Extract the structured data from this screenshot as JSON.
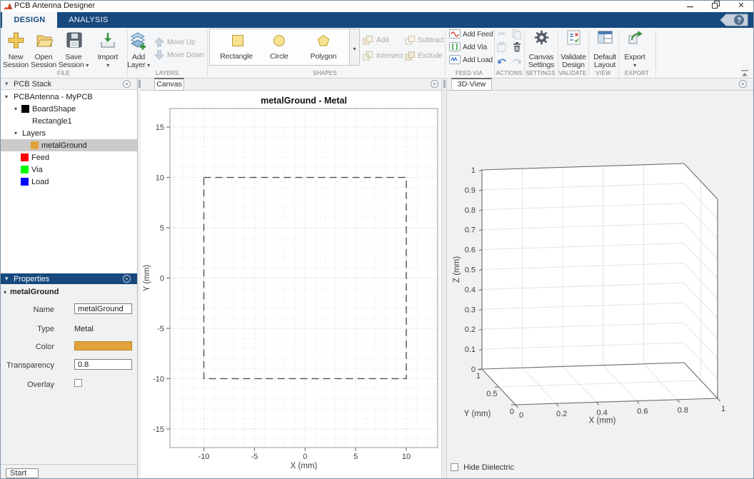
{
  "titlebar": {
    "title": "PCB Antenna Designer"
  },
  "icons": {
    "caret_down": "▾",
    "tree_caret": "▾",
    "close": "✕",
    "help": "?",
    "scissors": "✂"
  },
  "ribbon": {
    "tabs": {
      "design": "DESIGN",
      "analysis": "ANALYSIS"
    },
    "section_labels": {
      "file": "FILE",
      "layers": "LAYERS",
      "shapes": "SHAPES",
      "feed_via": "FEED VIA",
      "actions": "ACTIONS",
      "settings": "SETTINGS",
      "validate": "VALIDATE",
      "view": "VIEW",
      "export": "EXPORT"
    },
    "file": {
      "new1": "New",
      "new2": "Session",
      "open1": "Open",
      "open2": "Session",
      "save1": "Save",
      "save2": "Session",
      "import": "Import"
    },
    "layers": {
      "add1": "Add",
      "add2": "Layer",
      "move_up": "Move Up",
      "move_down": "Move Down"
    },
    "shapes": {
      "rectangle": "Rectangle",
      "circle": "Circle",
      "polygon": "Polygon"
    },
    "boolean": {
      "add": "Add",
      "subtract": "Subtract",
      "intersect": "Intersect",
      "exclude": "Exclude"
    },
    "feed_via": {
      "add_feed": "Add Feed",
      "add_via": "Add Via",
      "add_load": "Add Load"
    },
    "settings": {
      "l1": "Canvas",
      "l2": "Settings"
    },
    "validate": {
      "l1": "Validate",
      "l2": "Design"
    },
    "view": {
      "l1": "Default",
      "l2": "Layout"
    },
    "export": {
      "label": "Export"
    }
  },
  "pcb_stack": {
    "header": "PCB Stack",
    "tree": [
      {
        "label": "PCBAntenna - MyPCB"
      },
      {
        "label": "BoardShape",
        "color": "#000000"
      },
      {
        "label": "Rectangle1"
      },
      {
        "label": "Layers"
      },
      {
        "label": "metalGround",
        "color": "#E2A33C",
        "selected": true
      },
      {
        "label": "Feed",
        "color": "#FF0000"
      },
      {
        "label": "Via",
        "color": "#00FF00"
      },
      {
        "label": "Load",
        "color": "#0000FF"
      }
    ]
  },
  "properties": {
    "header": "Properties",
    "group": "metalGround",
    "name_label": "Name",
    "name_value": "metalGround",
    "type_label": "Type",
    "type_value": "Metal",
    "color_label": "Color",
    "color_value": "#E2A33C",
    "transparency_label": "Transparency",
    "transparency_value": "0.8",
    "overlay_label": "Overlay",
    "overlay_checked": false
  },
  "status": {
    "start": "Start"
  },
  "doc_tabs": {
    "canvas": "Canvas",
    "view3d": "3D-View"
  },
  "view3d_panel": {
    "hide_dielectric": "Hide Dielectric",
    "checked": false
  },
  "chart_data": [
    {
      "id": "canvas2d",
      "type": "line",
      "title": "metalGround - Metal",
      "xlabel": "X (mm)",
      "ylabel": "Y (mm)",
      "xlim": [
        -13.35,
        13.1
      ],
      "ylim": [
        -16.85,
        16.85
      ],
      "xticks": [
        -10,
        -5,
        0,
        5,
        10
      ],
      "yticks": [
        -15,
        -10,
        -5,
        0,
        5,
        10,
        15
      ],
      "grid": true,
      "minor_grid": true,
      "series": [
        {
          "name": "metalGround outline",
          "line_style": "dashed",
          "color": "#4f4f4f",
          "x": [
            -10,
            10,
            10,
            -10,
            -10
          ],
          "y": [
            10,
            10,
            -10,
            -10,
            10
          ]
        }
      ]
    },
    {
      "id": "view3d",
      "type": "3d-axes",
      "xlabel": "X (mm)",
      "ylabel": "Y (mm)",
      "zlabel": "Z (mm)",
      "xlim": [
        0,
        1
      ],
      "ylim": [
        0,
        1
      ],
      "zlim": [
        0,
        1
      ],
      "xticks": [
        0,
        0.2,
        0.4,
        0.6,
        0.8,
        1
      ],
      "yticks": [
        0,
        0.5,
        1
      ],
      "zticks": [
        0,
        0.1,
        0.2,
        0.3,
        0.4,
        0.5,
        0.6,
        0.7,
        0.8,
        0.9,
        1
      ],
      "view": "default 3d"
    }
  ],
  "colors": {
    "accent_blue": "#17497E",
    "layer_gold": "#E2A33C",
    "feed_red": "#FF0000",
    "via_green": "#00FF00",
    "load_blue": "#0000FF"
  }
}
